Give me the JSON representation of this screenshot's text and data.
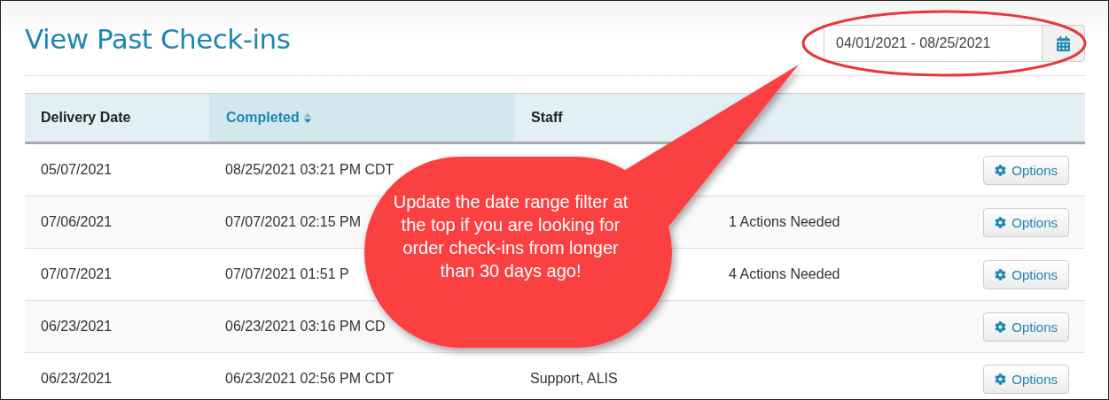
{
  "title": "View Past Check-ins",
  "date_range": {
    "value": "04/01/2021 - 08/25/2021"
  },
  "table": {
    "columns": [
      {
        "label": "Delivery Date",
        "sorted": false
      },
      {
        "label": "Completed",
        "sorted": true
      },
      {
        "label": "Staff",
        "sorted": false
      }
    ],
    "rows": [
      {
        "delivery_date": "05/07/2021",
        "completed": "08/25/2021 03:21 PM CDT",
        "staff": "",
        "actions": "",
        "button": "Options"
      },
      {
        "delivery_date": "07/06/2021",
        "completed": "07/07/2021 02:15 PM",
        "staff": "",
        "actions": "1 Actions Needed",
        "button": "Options"
      },
      {
        "delivery_date": "07/07/2021",
        "completed": "07/07/2021 01:51 P",
        "staff": "",
        "actions": "4 Actions Needed",
        "button": "Options"
      },
      {
        "delivery_date": "06/23/2021",
        "completed": "06/23/2021 03:16 PM CD",
        "staff": "",
        "actions": "",
        "button": "Options"
      },
      {
        "delivery_date": "06/23/2021",
        "completed": "06/23/2021 02:56 PM CDT",
        "staff": "Support, ALIS",
        "actions": "",
        "button": "Options"
      }
    ]
  },
  "callout": {
    "text": "Update the date range filter at the top if you are looking for order check-ins from longer than 30 days ago!"
  }
}
